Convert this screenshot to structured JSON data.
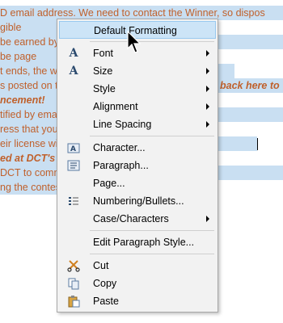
{
  "document": {
    "lines": [
      {
        "text": "D email address. We need to contact the Winner, so dispos",
        "style": "normal"
      },
      {
        "text": "gible",
        "style": "normal"
      },
      {
        "text": "be earned by                                                    , Instagram, a",
        "style": "normal"
      },
      {
        "text": "be page",
        "style": "normal"
      },
      {
        "text": "t ends, the w                                                  n",
        "style": "normal"
      },
      {
        "text": "s posted on th                                          back here to",
        "style": "mixed",
        "bold_part": "back here to"
      },
      {
        "text": "ncement!",
        "style": "bold"
      },
      {
        "text": "tified by ema                                             nter the conte",
        "style": "normal"
      },
      {
        "text": "ress that you",
        "style": "normal"
      },
      {
        "text": "eir license wi                                            5) day period,",
        "style": "normal"
      },
      {
        "text": "ed at DCT's s",
        "style": "bold"
      },
      {
        "text": "DCT to comm                                             ng the addres",
        "style": "normal"
      },
      {
        "text": "ng the contes",
        "style": "normal"
      }
    ]
  },
  "context_menu": {
    "items": [
      {
        "label": "Default Formatting",
        "icon": "",
        "submenu": false,
        "highlighted": true
      },
      {
        "label": "Font",
        "icon": "font-icon",
        "submenu": true
      },
      {
        "label": "Size",
        "icon": "font-size-icon",
        "submenu": true
      },
      {
        "label": "Style",
        "icon": "",
        "submenu": true
      },
      {
        "label": "Alignment",
        "icon": "",
        "submenu": true
      },
      {
        "label": "Line Spacing",
        "icon": "",
        "submenu": true
      },
      {
        "label": "Character...",
        "icon": "character-icon",
        "submenu": false
      },
      {
        "label": "Paragraph...",
        "icon": "paragraph-icon",
        "submenu": false
      },
      {
        "label": "Page...",
        "icon": "",
        "submenu": false
      },
      {
        "label": "Numbering/Bullets...",
        "icon": "numbering-icon",
        "submenu": false
      },
      {
        "label": "Case/Characters",
        "icon": "",
        "submenu": true
      },
      {
        "label": "Edit Paragraph Style...",
        "icon": "",
        "submenu": false
      },
      {
        "label": "Cut",
        "icon": "scissors-icon",
        "submenu": false
      },
      {
        "label": "Copy",
        "icon": "copy-icon",
        "submenu": false
      },
      {
        "label": "Paste",
        "icon": "paste-icon",
        "submenu": false
      }
    ]
  },
  "colors": {
    "selection_bg": "#c9dff2",
    "doc_text": "#c0602b",
    "menu_bg": "#f2f2f2",
    "highlight_bg": "#cce4f7"
  }
}
